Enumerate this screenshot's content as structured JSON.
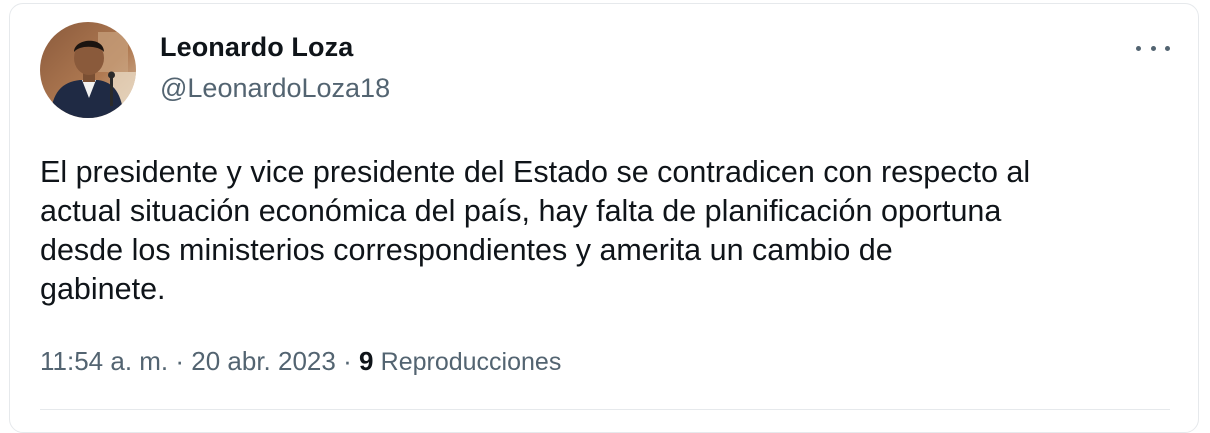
{
  "author": {
    "name": "Leonardo Loza",
    "handle": "@LeonardoLoza18"
  },
  "tweet": {
    "text": "El presidente y vice presidente del Estado se contradicen con respecto al\nactual situación económica del país, hay falta de planificación oportuna\ndesde los ministerios correspondientes y amerita un cambio de\ngabinete.",
    "time": "11:54 a. m.",
    "separator": " · ",
    "date": "20 abr. 2023",
    "views_count": "9",
    "views_label": "Reproducciones"
  },
  "icons": {
    "more": "more-horizontal-icon",
    "avatar": "profile-photo"
  },
  "colors": {
    "primary_text": "#0f1419",
    "secondary_text": "#536471",
    "border": "#e6e9ec"
  }
}
